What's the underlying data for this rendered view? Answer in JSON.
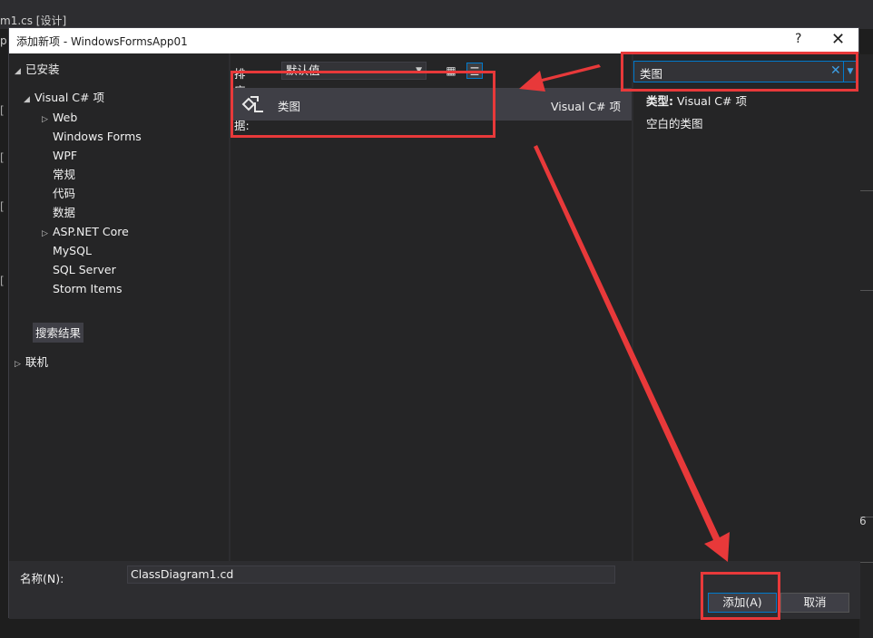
{
  "background": {
    "tab_text": "m1.cs [设计]",
    "left_fragment": "p",
    "status_number": "6"
  },
  "dialog": {
    "title": "添加新项 - WindowsFormsApp01",
    "help_label": "?",
    "close_label": "✕"
  },
  "tree": {
    "installed": "已安装",
    "visual_csharp": "Visual C# 项",
    "items": [
      "Web",
      "Windows Forms",
      "WPF",
      "常规",
      "代码",
      "数据",
      "ASP.NET Core",
      "MySQL",
      "SQL Server",
      "Storm Items"
    ],
    "search_results": "搜索结果",
    "online": "联机"
  },
  "sort": {
    "label": "排序依据:",
    "value": "默认值"
  },
  "templates": [
    {
      "name": "类图",
      "type": "Visual C# 项",
      "icon": "class-diagram-icon"
    }
  ],
  "search": {
    "value": "类图"
  },
  "details": {
    "type_label": "类型:",
    "type_value": "Visual C# 项",
    "description": "空白的类图"
  },
  "name_field": {
    "label": "名称(N):",
    "value": "ClassDiagram1.cd"
  },
  "buttons": {
    "add": "添加(A)",
    "cancel": "取消"
  },
  "colors": {
    "accent": "#007acc",
    "annotation": "#e8393a",
    "panel": "#252526",
    "dialog": "#2d2d30"
  }
}
